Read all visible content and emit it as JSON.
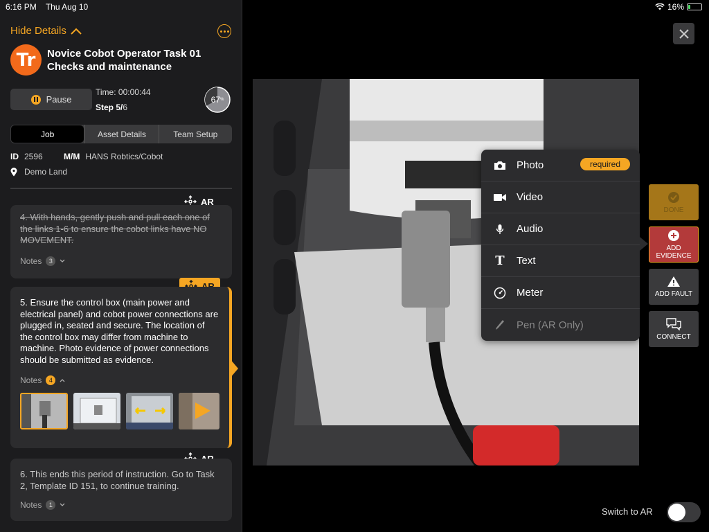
{
  "status_bar": {
    "time": "6:16 PM",
    "date": "Thu Aug 10",
    "battery": "16%",
    "battery_level": 0.16
  },
  "header": {
    "hide_details": "Hide Details",
    "logo_text": "Tr"
  },
  "task": {
    "title_line1": "Novice Cobot Operator Task 01",
    "title_line2": "Checks and maintenance",
    "pause_label": "Pause",
    "time": "Time: 00:00:44",
    "step_label": "Step 5/",
    "step_total": "6",
    "progress": "67",
    "progress_value": 0.67,
    "progress_unit": "%"
  },
  "tabs": [
    "Job",
    "Asset Details",
    "Team Setup"
  ],
  "info": {
    "id_label": "ID",
    "id_value": "2596",
    "mm_label": "M/M",
    "mm_value": "HANS Robtics/Cobot",
    "location": "Demo Land"
  },
  "steps": [
    {
      "ar": "AR",
      "text": "4.  With hands, gently push and pull each one of the links  1-6 to ensure the cobot links have NO MOVEMENT.",
      "notes_label": "Notes",
      "notes_count": "3"
    },
    {
      "ar": "AR",
      "text": "5.  Ensure the control box (main power and electrical panel) and cobot power connections are plugged in, seated and secure. The location of the control box may differ from machine to machine. Photo evidence of power connections should be submitted as evidence.",
      "notes_label": "Notes",
      "notes_count": "4"
    },
    {
      "ar": "AR",
      "text": "6.  This ends this period of instruction.  Go to Task 2, Template ID 151, to continue training.",
      "notes_label": "Notes",
      "notes_count": "1"
    }
  ],
  "evidence_menu": {
    "items": [
      {
        "label": "Photo",
        "icon": "camera-icon"
      },
      {
        "label": "Video",
        "icon": "video-icon"
      },
      {
        "label": "Audio",
        "icon": "microphone-icon"
      },
      {
        "label": "Text",
        "icon": "text-icon"
      },
      {
        "label": "Meter",
        "icon": "meter-icon"
      },
      {
        "label": "Pen (AR Only)",
        "icon": "pen-icon"
      }
    ],
    "required_label": "required"
  },
  "side_buttons": {
    "done": "DONE",
    "add_evidence_1": "ADD",
    "add_evidence_2": "EVIDENCE",
    "add_fault": "ADD FAULT",
    "connect": "CONNECT"
  },
  "footer": {
    "switch_to_ar": "Switch to AR"
  },
  "colors": {
    "accent": "#f5a623",
    "logo": "#f26a1b",
    "add_evidence": "#b33a3a",
    "panel": "#1c1c1e"
  }
}
